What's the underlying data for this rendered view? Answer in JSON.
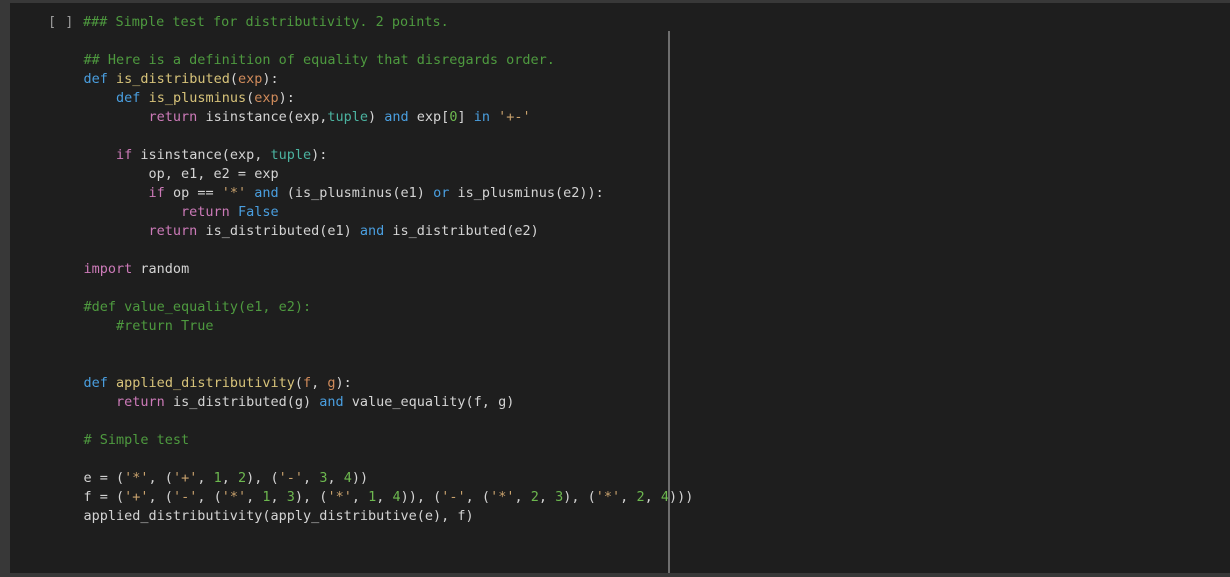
{
  "notebook": {
    "cell": {
      "prompt_label": "[ ]",
      "language": "python",
      "colors": {
        "page_background": "#383838",
        "cell_background": "#1e1e1e",
        "divider": "#6e6e6e",
        "prompt_text": "#9a9a9a",
        "default_text": "#d4d4d4",
        "comment": "#4e9a3f",
        "keyword_statement": "#cc7ab8",
        "keyword_operator": "#4a9fe0",
        "function_name": "#d7c37a",
        "parameter": "#d08b5b",
        "builtin_type": "#4bb3a0",
        "string": "#c9a26d",
        "number": "#6db84f"
      },
      "source_lines": [
        [
          {
            "t": "### Simple test for distributivity. 2 points.",
            "c": "t-com"
          }
        ],
        [
          {
            "t": "",
            "c": "t-pl"
          }
        ],
        [
          {
            "t": "    ",
            "c": "t-pl"
          },
          {
            "t": "## Here is a definition of equality that disregards order.",
            "c": "t-com"
          }
        ],
        [
          {
            "t": "    ",
            "c": "t-pl"
          },
          {
            "t": "def",
            "c": "t-kw2"
          },
          {
            "t": " ",
            "c": "t-pl"
          },
          {
            "t": "is_distributed",
            "c": "t-fn"
          },
          {
            "t": "(",
            "c": "t-pl"
          },
          {
            "t": "exp",
            "c": "t-par"
          },
          {
            "t": "):",
            "c": "t-pl"
          }
        ],
        [
          {
            "t": "        ",
            "c": "t-pl"
          },
          {
            "t": "def",
            "c": "t-kw2"
          },
          {
            "t": " ",
            "c": "t-pl"
          },
          {
            "t": "is_plusminus",
            "c": "t-fn"
          },
          {
            "t": "(",
            "c": "t-pl"
          },
          {
            "t": "exp",
            "c": "t-par"
          },
          {
            "t": "):",
            "c": "t-pl"
          }
        ],
        [
          {
            "t": "            ",
            "c": "t-pl"
          },
          {
            "t": "return",
            "c": "t-kw"
          },
          {
            "t": " isinstance(exp,",
            "c": "t-pl"
          },
          {
            "t": "tuple",
            "c": "t-bi"
          },
          {
            "t": ") ",
            "c": "t-pl"
          },
          {
            "t": "and",
            "c": "t-kw2"
          },
          {
            "t": " exp[",
            "c": "t-pl"
          },
          {
            "t": "0",
            "c": "t-num"
          },
          {
            "t": "] ",
            "c": "t-pl"
          },
          {
            "t": "in",
            "c": "t-kw2"
          },
          {
            "t": " ",
            "c": "t-pl"
          },
          {
            "t": "'+-'",
            "c": "t-str"
          }
        ],
        [
          {
            "t": "",
            "c": "t-pl"
          }
        ],
        [
          {
            "t": "        ",
            "c": "t-pl"
          },
          {
            "t": "if",
            "c": "t-kw"
          },
          {
            "t": " isinstance(exp, ",
            "c": "t-pl"
          },
          {
            "t": "tuple",
            "c": "t-bi"
          },
          {
            "t": "):",
            "c": "t-pl"
          }
        ],
        [
          {
            "t": "            op, e1, e2 = exp",
            "c": "t-pl"
          }
        ],
        [
          {
            "t": "            ",
            "c": "t-pl"
          },
          {
            "t": "if",
            "c": "t-kw"
          },
          {
            "t": " op == ",
            "c": "t-pl"
          },
          {
            "t": "'*'",
            "c": "t-str"
          },
          {
            "t": " ",
            "c": "t-pl"
          },
          {
            "t": "and",
            "c": "t-kw2"
          },
          {
            "t": " (is_plusminus(e1) ",
            "c": "t-pl"
          },
          {
            "t": "or",
            "c": "t-kw2"
          },
          {
            "t": " is_plusminus(e2)):",
            "c": "t-pl"
          }
        ],
        [
          {
            "t": "                ",
            "c": "t-pl"
          },
          {
            "t": "return",
            "c": "t-kw"
          },
          {
            "t": " ",
            "c": "t-pl"
          },
          {
            "t": "False",
            "c": "t-kw2"
          }
        ],
        [
          {
            "t": "            ",
            "c": "t-pl"
          },
          {
            "t": "return",
            "c": "t-kw"
          },
          {
            "t": " is_distributed(e1) ",
            "c": "t-pl"
          },
          {
            "t": "and",
            "c": "t-kw2"
          },
          {
            "t": " is_distributed(e2)",
            "c": "t-pl"
          }
        ],
        [
          {
            "t": "",
            "c": "t-pl"
          }
        ],
        [
          {
            "t": "    ",
            "c": "t-pl"
          },
          {
            "t": "import",
            "c": "t-kw"
          },
          {
            "t": " random",
            "c": "t-pl"
          }
        ],
        [
          {
            "t": "",
            "c": "t-pl"
          }
        ],
        [
          {
            "t": "    ",
            "c": "t-pl"
          },
          {
            "t": "#def value_equality(e1, e2):",
            "c": "t-com"
          }
        ],
        [
          {
            "t": "        ",
            "c": "t-pl"
          },
          {
            "t": "#return True",
            "c": "t-com"
          }
        ],
        [
          {
            "t": "",
            "c": "t-pl"
          }
        ],
        [
          {
            "t": "",
            "c": "t-pl"
          }
        ],
        [
          {
            "t": "    ",
            "c": "t-pl"
          },
          {
            "t": "def",
            "c": "t-kw2"
          },
          {
            "t": " ",
            "c": "t-pl"
          },
          {
            "t": "applied_distributivity",
            "c": "t-fn"
          },
          {
            "t": "(",
            "c": "t-pl"
          },
          {
            "t": "f",
            "c": "t-par"
          },
          {
            "t": ", ",
            "c": "t-pl"
          },
          {
            "t": "g",
            "c": "t-par"
          },
          {
            "t": "):",
            "c": "t-pl"
          }
        ],
        [
          {
            "t": "        ",
            "c": "t-pl"
          },
          {
            "t": "return",
            "c": "t-kw"
          },
          {
            "t": " is_distributed(g) ",
            "c": "t-pl"
          },
          {
            "t": "and",
            "c": "t-kw2"
          },
          {
            "t": " value_equality(f, g)",
            "c": "t-pl"
          }
        ],
        [
          {
            "t": "",
            "c": "t-pl"
          }
        ],
        [
          {
            "t": "    ",
            "c": "t-pl"
          },
          {
            "t": "# Simple test",
            "c": "t-com"
          }
        ],
        [
          {
            "t": "",
            "c": "t-pl"
          }
        ],
        [
          {
            "t": "    e = (",
            "c": "t-pl"
          },
          {
            "t": "'*'",
            "c": "t-str"
          },
          {
            "t": ", (",
            "c": "t-pl"
          },
          {
            "t": "'+'",
            "c": "t-str"
          },
          {
            "t": ", ",
            "c": "t-pl"
          },
          {
            "t": "1",
            "c": "t-num"
          },
          {
            "t": ", ",
            "c": "t-pl"
          },
          {
            "t": "2",
            "c": "t-num"
          },
          {
            "t": "), (",
            "c": "t-pl"
          },
          {
            "t": "'-'",
            "c": "t-str"
          },
          {
            "t": ", ",
            "c": "t-pl"
          },
          {
            "t": "3",
            "c": "t-num"
          },
          {
            "t": ", ",
            "c": "t-pl"
          },
          {
            "t": "4",
            "c": "t-num"
          },
          {
            "t": "))",
            "c": "t-pl"
          }
        ],
        [
          {
            "t": "    f = (",
            "c": "t-pl"
          },
          {
            "t": "'+'",
            "c": "t-str"
          },
          {
            "t": ", (",
            "c": "t-pl"
          },
          {
            "t": "'-'",
            "c": "t-str"
          },
          {
            "t": ", (",
            "c": "t-pl"
          },
          {
            "t": "'*'",
            "c": "t-str"
          },
          {
            "t": ", ",
            "c": "t-pl"
          },
          {
            "t": "1",
            "c": "t-num"
          },
          {
            "t": ", ",
            "c": "t-pl"
          },
          {
            "t": "3",
            "c": "t-num"
          },
          {
            "t": "), (",
            "c": "t-pl"
          },
          {
            "t": "'*'",
            "c": "t-str"
          },
          {
            "t": ", ",
            "c": "t-pl"
          },
          {
            "t": "1",
            "c": "t-num"
          },
          {
            "t": ", ",
            "c": "t-pl"
          },
          {
            "t": "4",
            "c": "t-num"
          },
          {
            "t": ")), (",
            "c": "t-pl"
          },
          {
            "t": "'-'",
            "c": "t-str"
          },
          {
            "t": ", (",
            "c": "t-pl"
          },
          {
            "t": "'*'",
            "c": "t-str"
          },
          {
            "t": ", ",
            "c": "t-pl"
          },
          {
            "t": "2",
            "c": "t-num"
          },
          {
            "t": ", ",
            "c": "t-pl"
          },
          {
            "t": "3",
            "c": "t-num"
          },
          {
            "t": "), (",
            "c": "t-pl"
          },
          {
            "t": "'*'",
            "c": "t-str"
          },
          {
            "t": ", ",
            "c": "t-pl"
          },
          {
            "t": "2",
            "c": "t-num"
          },
          {
            "t": ", ",
            "c": "t-pl"
          },
          {
            "t": "4",
            "c": "t-num"
          },
          {
            "t": ")))",
            "c": "t-pl"
          }
        ],
        [
          {
            "t": "    applied_distributivity(apply_distributive(e), f)",
            "c": "t-pl"
          }
        ]
      ]
    }
  }
}
